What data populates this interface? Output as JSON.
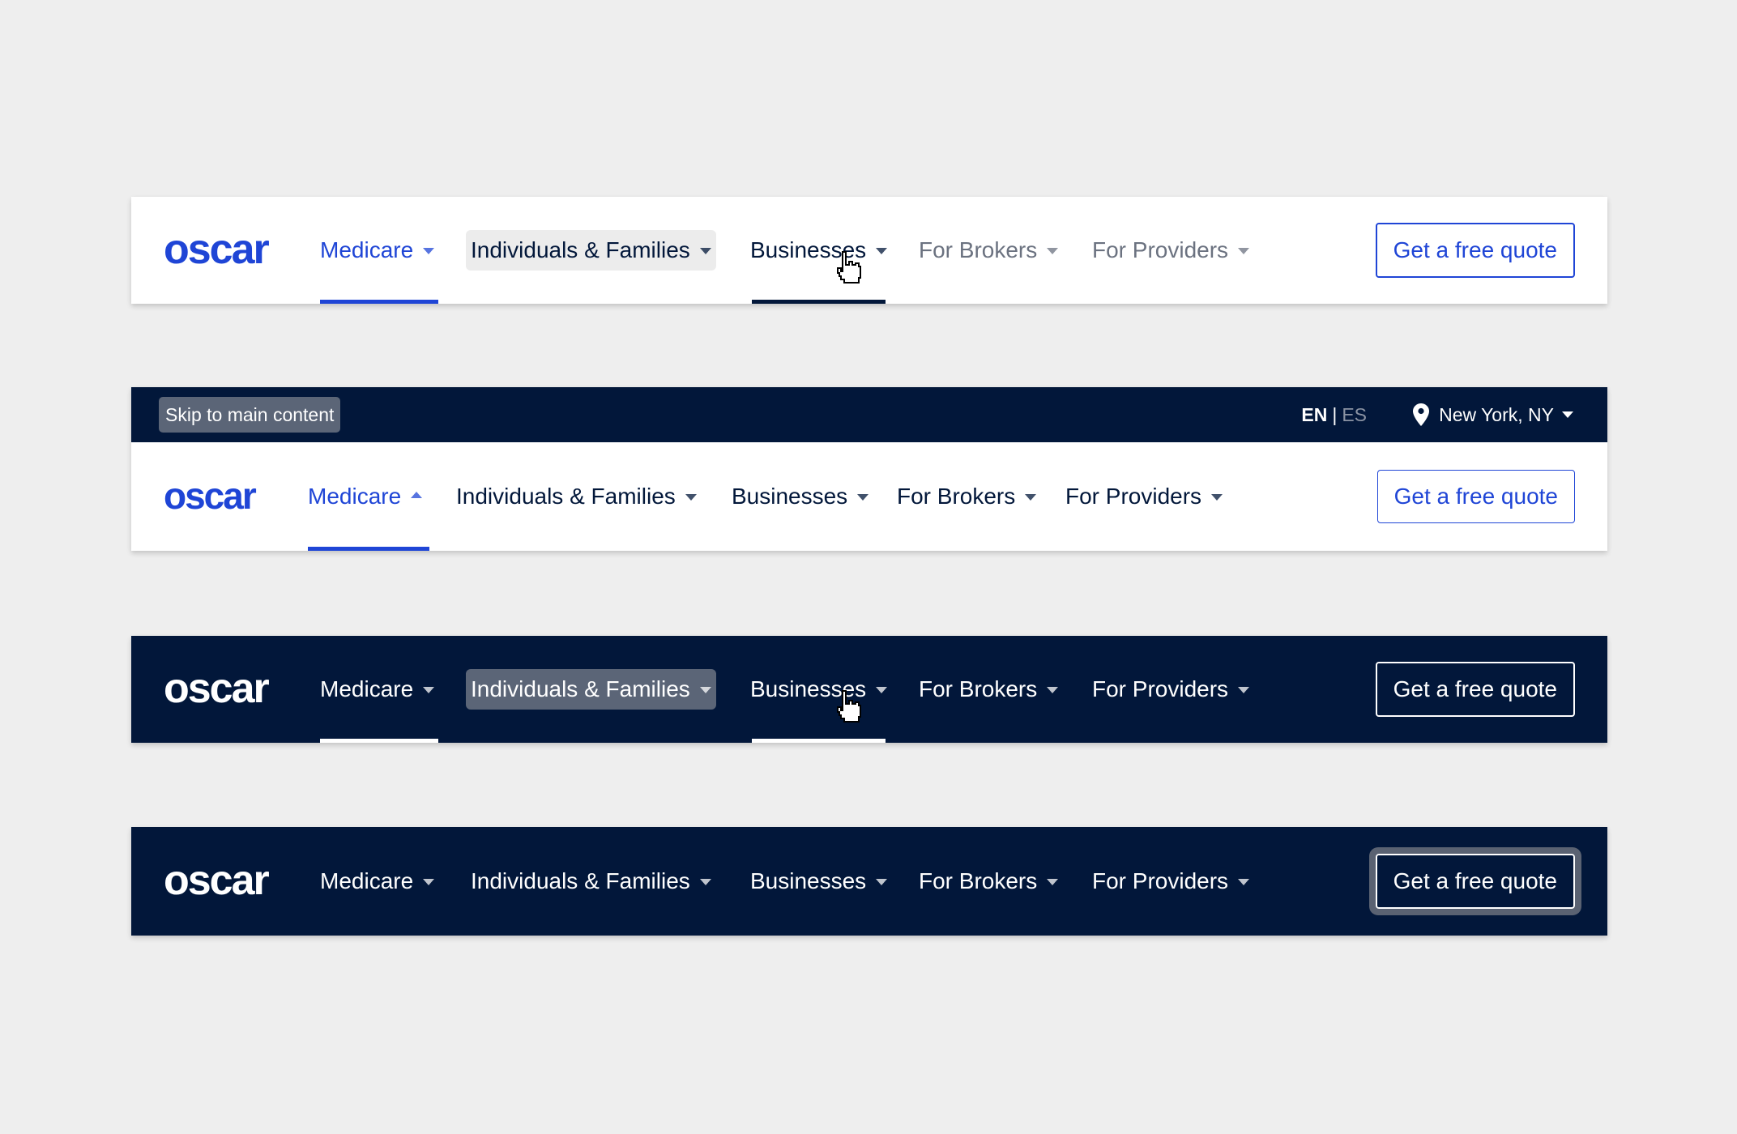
{
  "logo_text": "oscar",
  "nav_labels": {
    "medicare": "Medicare",
    "individuals": "Individuals & Families",
    "businesses": "Businesses",
    "brokers": "For Brokers",
    "providers": "For Providers"
  },
  "cta_label": "Get a free quote",
  "top_strip": {
    "skip_link": "Skip to main content",
    "lang_en": "EN",
    "lang_sep": "|",
    "lang_es": "ES",
    "location": "New York, NY"
  },
  "colors": {
    "brand_blue": "#1f45d6",
    "navy": "#02173a",
    "muted_gray": "#6b7280",
    "page_bg": "#eeeeee"
  },
  "icons": {
    "caret": "chevron-down-icon",
    "caret_up": "chevron-up-icon",
    "pin": "location-pin-icon",
    "cursor": "hand-pointer-icon"
  }
}
